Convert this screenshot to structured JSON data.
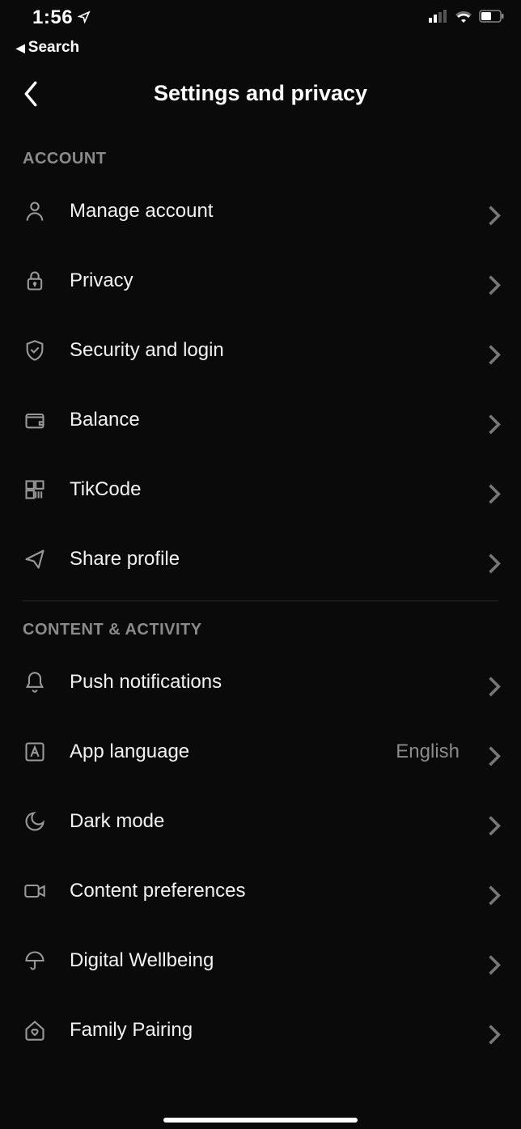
{
  "status": {
    "time": "1:56",
    "back_app": "Search"
  },
  "header": {
    "title": "Settings and privacy"
  },
  "sections": [
    {
      "title": "ACCOUNT",
      "items": [
        {
          "icon": "person",
          "label": "Manage account"
        },
        {
          "icon": "lock",
          "label": "Privacy"
        },
        {
          "icon": "shield",
          "label": "Security and login"
        },
        {
          "icon": "wallet",
          "label": "Balance"
        },
        {
          "icon": "qrcode",
          "label": "TikCode"
        },
        {
          "icon": "share",
          "label": "Share profile"
        }
      ]
    },
    {
      "title": "CONTENT & ACTIVITY",
      "items": [
        {
          "icon": "bell",
          "label": "Push notifications"
        },
        {
          "icon": "language",
          "label": "App language",
          "value": "English"
        },
        {
          "icon": "moon",
          "label": "Dark mode"
        },
        {
          "icon": "video",
          "label": "Content preferences"
        },
        {
          "icon": "umbrella",
          "label": "Digital Wellbeing"
        },
        {
          "icon": "home-heart",
          "label": "Family Pairing"
        }
      ]
    }
  ]
}
